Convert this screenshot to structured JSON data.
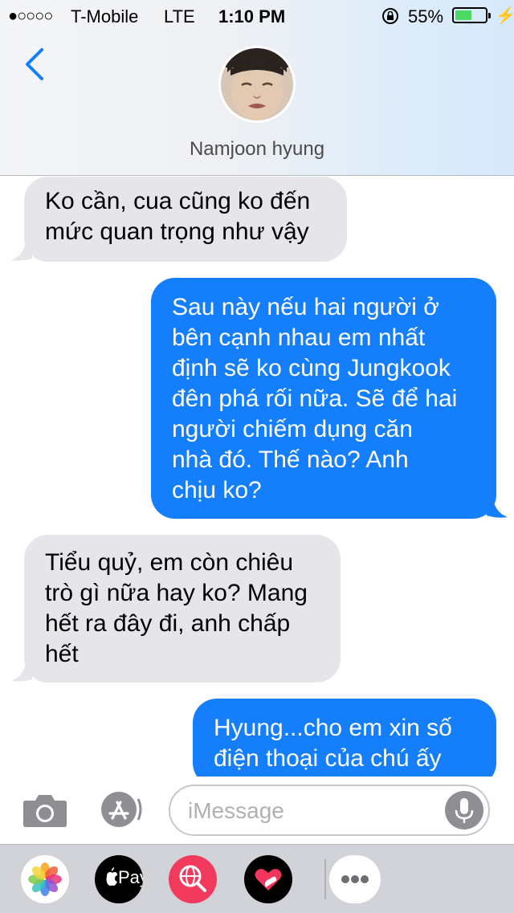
{
  "status_bar": {
    "signal": "●○○○○",
    "carrier": "T-Mobile",
    "network": "LTE",
    "time": "1:10 PM",
    "battery_percent": "55%",
    "battery_level": 0.55
  },
  "header": {
    "contact_name": "Namjoon hyung"
  },
  "messages": [
    {
      "direction": "incoming",
      "lines": [
        "Ko cần, cua cũng ko đến",
        "mức quan trọng như vậy"
      ]
    },
    {
      "direction": "outgoing",
      "lines": [
        "Sau này nếu hai người ở",
        "bên cạnh nhau em nhất",
        "định sẽ ko cùng Jungkook",
        "đên phá rối nữa. Sẽ để hai",
        "người chiếm dụng căn",
        "nhà đó. Thế nào? Anh",
        "chịu ko?"
      ]
    },
    {
      "direction": "incoming",
      "lines": [
        "Tiểu quỷ, em còn chiêu",
        "trò gì nữa hay ko? Mang",
        "hết ra đây đi, anh chấp",
        "hết"
      ]
    },
    {
      "direction": "outgoing",
      "lines": [
        "Hyung...cho em xin số",
        "điện thoại của chú ấy"
      ]
    }
  ],
  "input": {
    "placeholder": "iMessage",
    "value": ""
  },
  "app_drawer": {
    "apps": [
      {
        "name": "photos-icon"
      },
      {
        "name": "apple-pay-icon",
        "label": "Pay"
      },
      {
        "name": "image-search-icon"
      },
      {
        "name": "digital-touch-icon"
      },
      {
        "name": "more-icon"
      }
    ]
  },
  "colors": {
    "outgoing_bubble": "#147efb",
    "incoming_bubble": "#e5e5ea",
    "accent": "#147efb",
    "battery_fill": "#4cd964"
  }
}
